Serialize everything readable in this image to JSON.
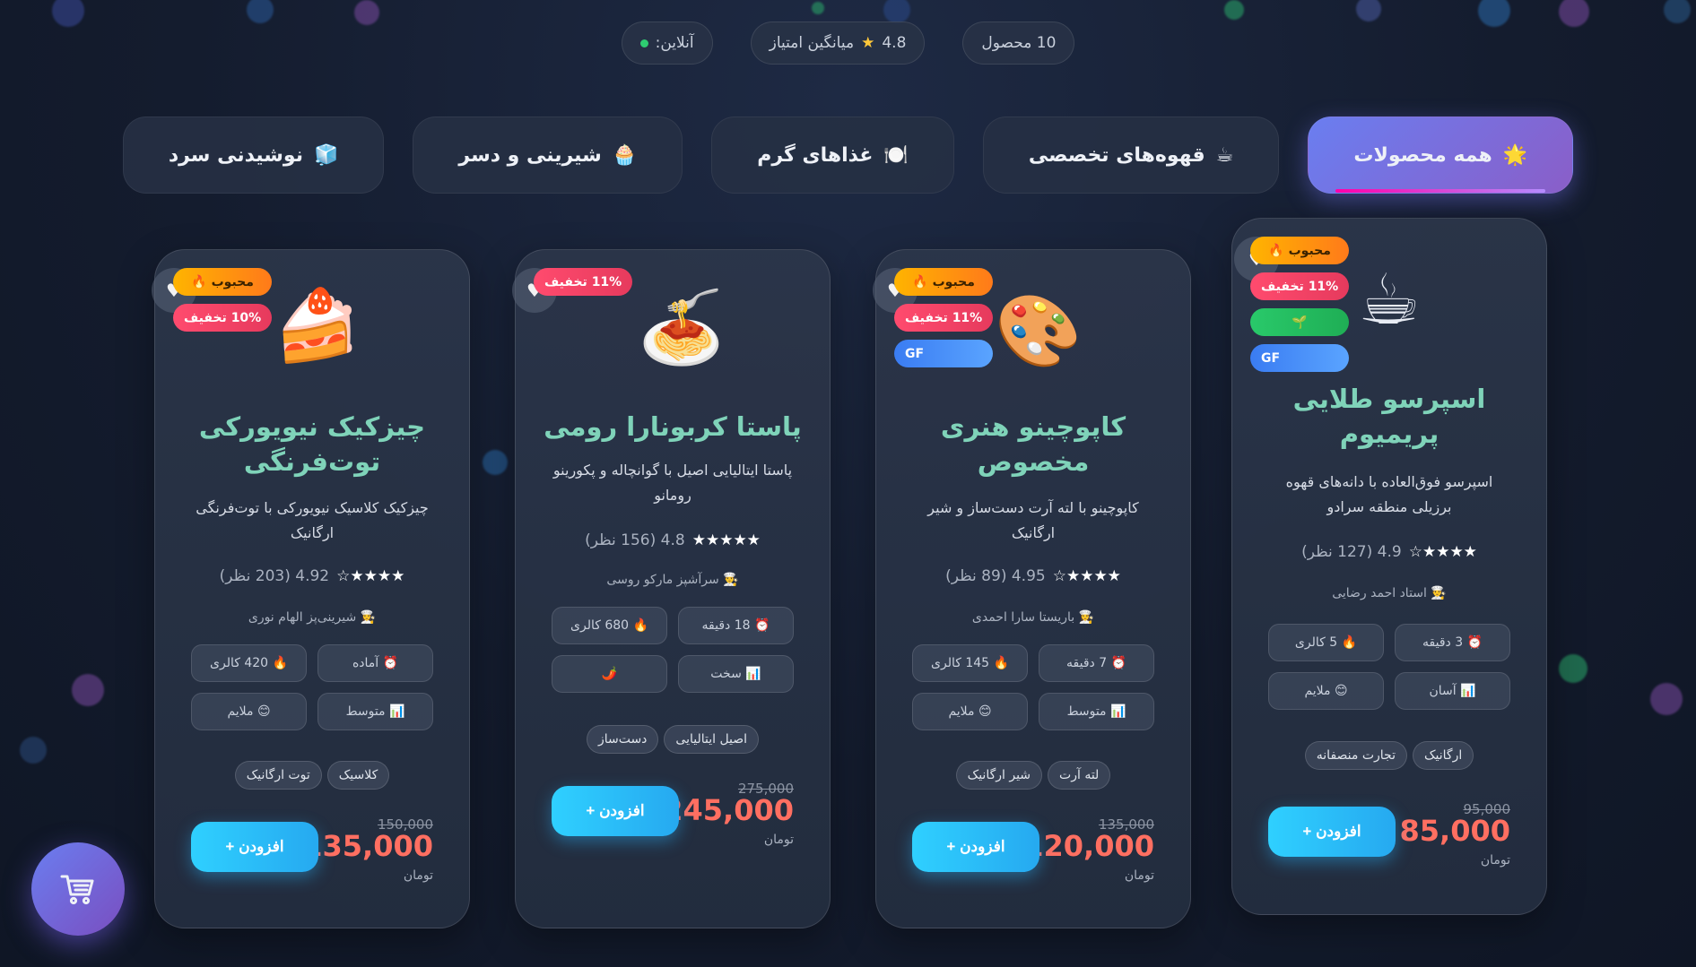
{
  "stats": {
    "products": "10 محصول",
    "rating_value": "4.8",
    "rating_label": "میانگین امتیاز",
    "online": "آنلاین:"
  },
  "categories": [
    {
      "icon": "🌟",
      "label": "همه محصولات",
      "active": true
    },
    {
      "icon": "☕",
      "label": "قهوه‌های تخصصی"
    },
    {
      "icon": "🍽️",
      "label": "غذاهای گرم"
    },
    {
      "icon": "🧁",
      "label": "شیرینی و دسر"
    },
    {
      "icon": "🧊",
      "label": "نوشیدنی سرد"
    }
  ],
  "cards": [
    {
      "emoji": "☕",
      "badges": [
        "محبوب 🔥",
        "11% تخفیف",
        "🌱",
        "GF"
      ],
      "title": "اسپرسو طلایی پریمیوم",
      "desc": "اسپرسو فوق‌العاده با دانه‌های قهوه برزیلی منطقه سرادو",
      "rating": "4.9 (127 نظر)",
      "stars": "★★★★☆",
      "chef": "👨‍🍳 استاد احمد رضایی",
      "metas": [
        "⏰ 3 دقیقه",
        "🔥 5 کالری",
        "📊 آسان",
        "😊 ملایم"
      ],
      "tags": [
        "ارگانیک",
        "تجارت منصفانه"
      ],
      "old_price": "95,000",
      "price": "85,000",
      "currency": "تومان",
      "add": "افزودن +"
    },
    {
      "emoji": "🎨",
      "badges": [
        "محبوب 🔥",
        "11% تخفیف",
        "GF"
      ],
      "title": "کاپوچینو هنری مخصوص",
      "desc": "کاپوچینو با لته آرت دست‌ساز و شیر ارگانیک",
      "rating": "4.95 (89 نظر)",
      "stars": "★★★★☆",
      "chef": "👩‍🍳 باریستا سارا احمدی",
      "metas": [
        "⏰ 7 دقیقه",
        "🔥 145 کالری",
        "📊 متوسط",
        "😊 ملایم"
      ],
      "tags": [
        "لته آرت",
        "شیر ارگانیک"
      ],
      "old_price": "135,000",
      "price": "120,000",
      "currency": "تومان",
      "add": "افزودن +"
    },
    {
      "emoji": "🍝",
      "badges": [
        "11% تخفیف"
      ],
      "title": "پاستا کربونارا رومی",
      "desc": "پاستا ایتالیایی اصیل با گوانچاله و پکورینو رومانو",
      "rating": "4.8 (156 نظر)",
      "stars": "★★★★★",
      "chef": "👨‍🍳 سرآشپز مارکو روسی",
      "metas": [
        "⏰ 18 دقیقه",
        "🔥 680 کالری",
        "📊 سخت",
        "🌶️"
      ],
      "tags": [
        "اصیل ایتالیایی",
        "دست‌ساز"
      ],
      "old_price": "275,000",
      "price": "245,000",
      "currency": "تومان",
      "add": "افزودن +"
    },
    {
      "emoji": "🍰",
      "badges": [
        "محبوب 🔥",
        "10% تخفیف"
      ],
      "title": "چیزکیک نیویورکی توت‌فرنگی",
      "desc": "چیزکیک کلاسیک نیویورکی با توت‌فرنگی ارگانیک",
      "rating": "4.92 (203 نظر)",
      "stars": "★★★★☆",
      "chef": "👩‍🍳 شیرینی‌پز الهام نوری",
      "metas": [
        "⏰ آماده",
        "🔥 420 کالری",
        "📊 متوسط",
        "😊 ملایم"
      ],
      "tags": [
        "کلاسیک",
        "توت ارگانیک"
      ],
      "old_price": "150,000",
      "price": "135,000",
      "currency": "تومان",
      "add": "افزودن +"
    }
  ],
  "cart_icon": "shopping-cart-icon"
}
